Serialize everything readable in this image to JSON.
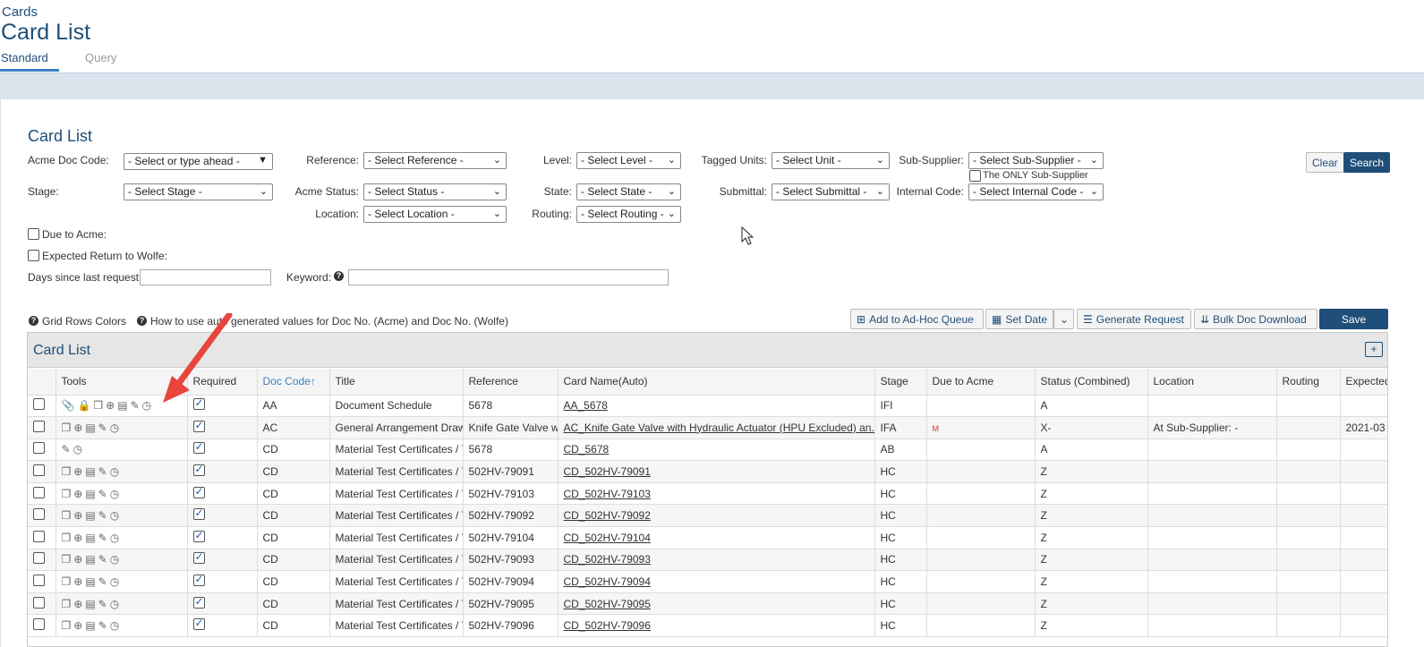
{
  "header": {
    "breadcrumb": "Cards",
    "title": "Card List",
    "tabs": [
      {
        "label": "Standard",
        "active": true
      },
      {
        "label": "Query",
        "active": false
      }
    ]
  },
  "filters": {
    "section_title": "Card List",
    "acme_doc_code": {
      "label": "Acme Doc Code:",
      "value": "- Select or type ahead -"
    },
    "reference": {
      "label": "Reference:",
      "value": "- Select Reference -"
    },
    "level": {
      "label": "Level:",
      "value": "- Select Level -"
    },
    "tagged_units": {
      "label": "Tagged Units:",
      "value": "- Select Unit -"
    },
    "sub_supplier": {
      "label": "Sub-Supplier:",
      "value": "- Select Sub-Supplier -"
    },
    "only_sub_supplier": {
      "label": "The ONLY Sub-Supplier",
      "checked": false
    },
    "stage": {
      "label": "Stage:",
      "value": "- Select Stage -"
    },
    "acme_status": {
      "label": "Acme Status:",
      "value": "- Select Status -"
    },
    "state": {
      "label": "State:",
      "value": "- Select State -"
    },
    "submittal": {
      "label": "Submittal:",
      "value": "- Select Submittal -"
    },
    "internal_code": {
      "label": "Internal Code:",
      "value": "- Select Internal Code -"
    },
    "location": {
      "label": "Location:",
      "value": "- Select Location -"
    },
    "routing": {
      "label": "Routing:",
      "value": "- Select Routing -"
    },
    "due_to_acme": {
      "label": "Due to Acme:",
      "checked": false
    },
    "expected_return": {
      "label": "Expected Return to Wolfe:",
      "checked": false
    },
    "days_since": {
      "label": "Days since last request:",
      "value": ""
    },
    "keyword": {
      "label": "Keyword:",
      "value": ""
    },
    "clear_label": "Clear",
    "search_label": "Search"
  },
  "links": {
    "grid_rows_colors": "Grid Rows Colors",
    "how_to_use": "How to use auto generated values for Doc No. (Acme) and Doc No. (Wolfe)"
  },
  "toolbar": {
    "add_adhoc": "Add to Ad-Hoc Queue",
    "set_date": "Set Date",
    "generate_request": "Generate Request",
    "bulk_doc_download": "Bulk Doc Download",
    "save": "Save"
  },
  "grid": {
    "title": "Card List",
    "columns": [
      "",
      "Tools",
      "Required",
      "Doc Code",
      "Title",
      "Reference",
      "Card Name(Auto)",
      "Stage",
      "Due to Acme",
      "Status (Combined)",
      "Location",
      "Routing",
      "Expected"
    ],
    "sort_indicator": "↑",
    "rows": [
      {
        "tools": [
          "paperclip-icon",
          "lock-icon",
          "copy-icon",
          "copy-add-icon",
          "list-icon",
          "pencil-icon",
          "clock-icon"
        ],
        "required": true,
        "doc_code": "AA",
        "title": "Document Schedule",
        "reference": "5678",
        "card_name": "AA_5678",
        "stage": "IFI",
        "due": "",
        "status": "A",
        "location": "",
        "routing": "",
        "expected": ""
      },
      {
        "tools": [
          "copy-icon",
          "copy-add-icon",
          "list-icon",
          "pencil-icon",
          "clock-icon"
        ],
        "required": true,
        "doc_code": "AC",
        "title": "General Arrangement Draw",
        "reference": "Knife Gate Valve wi",
        "card_name": "AC_Knife Gate Valve with Hydraulic Actuator (HPU Excluded) an...",
        "stage": "IFA",
        "due": "M",
        "status": "X-",
        "location": "At Sub-Supplier: -",
        "routing": "",
        "expected": "2021-03"
      },
      {
        "tools": [
          "pencil-icon",
          "clock-icon"
        ],
        "required": true,
        "doc_code": "CD",
        "title": "Material Test Certificates / T",
        "reference": "5678",
        "card_name": "CD_5678",
        "stage": "AB",
        "due": "",
        "status": "A",
        "location": "",
        "routing": "",
        "expected": ""
      },
      {
        "tools": [
          "copy-icon",
          "copy-add-icon",
          "list-icon",
          "pencil-icon",
          "clock-icon"
        ],
        "required": true,
        "doc_code": "CD",
        "title": "Material Test Certificates / T",
        "reference": "502HV-79091",
        "card_name": "CD_502HV-79091",
        "stage": "HC",
        "due": "",
        "status": "Z",
        "location": "",
        "routing": "",
        "expected": ""
      },
      {
        "tools": [
          "copy-icon",
          "copy-add-icon",
          "list-icon",
          "pencil-icon",
          "clock-icon"
        ],
        "required": true,
        "doc_code": "CD",
        "title": "Material Test Certificates / T",
        "reference": "502HV-79103",
        "card_name": "CD_502HV-79103",
        "stage": "HC",
        "due": "",
        "status": "Z",
        "location": "",
        "routing": "",
        "expected": ""
      },
      {
        "tools": [
          "copy-icon",
          "copy-add-icon",
          "list-icon",
          "pencil-icon",
          "clock-icon"
        ],
        "required": true,
        "doc_code": "CD",
        "title": "Material Test Certificates / T",
        "reference": "502HV-79092",
        "card_name": "CD_502HV-79092",
        "stage": "HC",
        "due": "",
        "status": "Z",
        "location": "",
        "routing": "",
        "expected": ""
      },
      {
        "tools": [
          "copy-icon",
          "copy-add-icon",
          "list-icon",
          "pencil-icon",
          "clock-icon"
        ],
        "required": true,
        "doc_code": "CD",
        "title": "Material Test Certificates / T",
        "reference": "502HV-79104",
        "card_name": "CD_502HV-79104",
        "stage": "HC",
        "due": "",
        "status": "Z",
        "location": "",
        "routing": "",
        "expected": ""
      },
      {
        "tools": [
          "copy-icon",
          "copy-add-icon",
          "list-icon",
          "pencil-icon",
          "clock-icon"
        ],
        "required": true,
        "doc_code": "CD",
        "title": "Material Test Certificates / T",
        "reference": "502HV-79093",
        "card_name": "CD_502HV-79093",
        "stage": "HC",
        "due": "",
        "status": "Z",
        "location": "",
        "routing": "",
        "expected": ""
      },
      {
        "tools": [
          "copy-icon",
          "copy-add-icon",
          "list-icon",
          "pencil-icon",
          "clock-icon"
        ],
        "required": true,
        "doc_code": "CD",
        "title": "Material Test Certificates / T",
        "reference": "502HV-79094",
        "card_name": "CD_502HV-79094",
        "stage": "HC",
        "due": "",
        "status": "Z",
        "location": "",
        "routing": "",
        "expected": ""
      },
      {
        "tools": [
          "copy-icon",
          "copy-add-icon",
          "list-icon",
          "pencil-icon",
          "clock-icon"
        ],
        "required": true,
        "doc_code": "CD",
        "title": "Material Test Certificates / T",
        "reference": "502HV-79095",
        "card_name": "CD_502HV-79095",
        "stage": "HC",
        "due": "",
        "status": "Z",
        "location": "",
        "routing": "",
        "expected": ""
      },
      {
        "tools": [
          "copy-icon",
          "copy-add-icon",
          "list-icon",
          "pencil-icon",
          "clock-icon"
        ],
        "required": true,
        "doc_code": "CD",
        "title": "Material Test Certificates / T",
        "reference": "502HV-79096",
        "card_name": "CD_502HV-79096",
        "stage": "HC",
        "due": "",
        "status": "Z",
        "location": "",
        "routing": "",
        "expected": ""
      }
    ]
  },
  "colors": {
    "brand": "#1f4e79",
    "accent": "#3d7fc1",
    "band": "#dde3ec",
    "arrow": "#e8453c"
  }
}
